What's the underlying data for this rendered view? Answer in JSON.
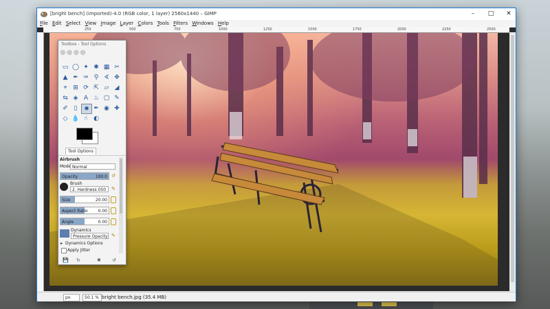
{
  "window": {
    "title": "[bright bench] (imported)-4.0 (RGB color, 1 layer) 2560x1440 – GIMP",
    "controls": [
      "minimize",
      "maximize",
      "close"
    ]
  },
  "menu": [
    "File",
    "Edit",
    "Select",
    "View",
    "Image",
    "Layer",
    "Colors",
    "Tools",
    "Filters",
    "Windows",
    "Help"
  ],
  "ruler": {
    "ticks": [
      "250",
      "500",
      "750",
      "1000",
      "1250",
      "1500",
      "1750",
      "2000",
      "2250",
      "2500"
    ]
  },
  "toolbox": {
    "title": "Toolbox - Tool Options",
    "tab": "Tool Options",
    "tool_name": "Airbrush",
    "mode_label": "Mode",
    "mode_value": "Normal",
    "opacity_label": "Opacity",
    "opacity_value": "100.0",
    "opacity": 1.0,
    "brush_label": "Brush",
    "brush_value": "2. Hardness 050",
    "size_label": "Size",
    "size_value": "20.00",
    "aspect_label": "Aspect Ratio",
    "aspect_value": "0.00",
    "angle_label": "Angle",
    "angle_value": "0.00",
    "dynamics_label": "Dynamics",
    "dynamics_value": "Pressure Opacity",
    "dynamics_options": "Dynamics Options",
    "apply_jitter": "Apply Jitter"
  },
  "status": {
    "unit": "px",
    "zoom": "50.1 %",
    "message": "bright bench.jpg (35.4 MB)"
  }
}
